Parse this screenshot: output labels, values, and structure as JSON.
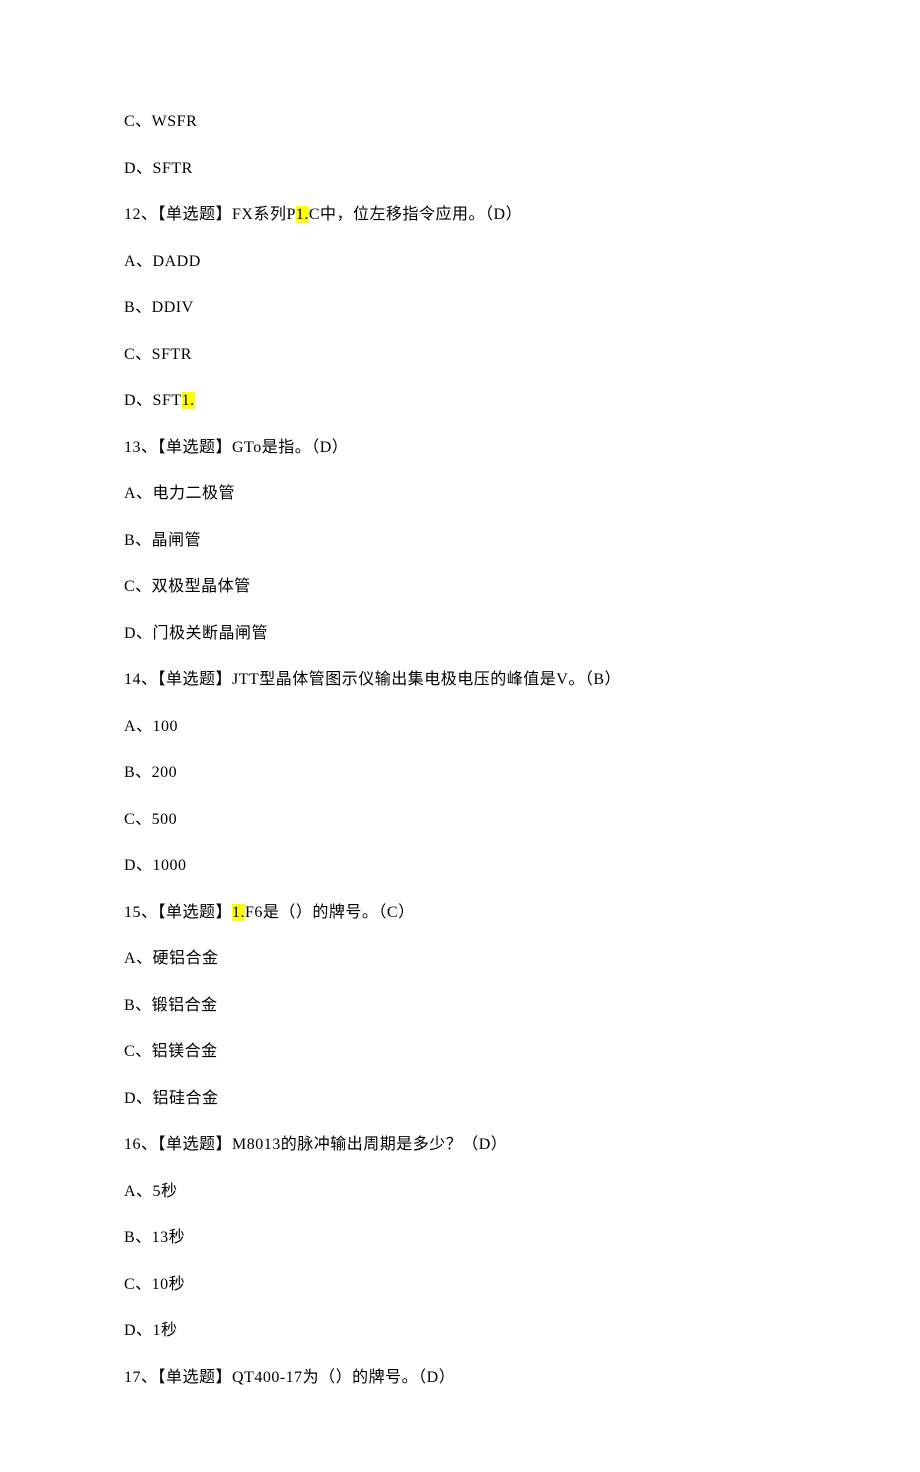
{
  "lines": {
    "l1": "C、WSFR",
    "l2": "D、SFTR",
    "l3_pre": "12、【单选题】FX系列P",
    "l3_hl": "1.",
    "l3_post": "C中，位左移指令应用。（D）",
    "l4": "A、DADD",
    "l5": "B、DDIV",
    "l6": "C、SFTR",
    "l7_pre": "D、SFT",
    "l7_hl": "1.",
    "l8": "13、【单选题】GTo是指。（D）",
    "l9": "A、电力二极管",
    "l10": "B、晶闸管",
    "l11": "C、双极型晶体管",
    "l12": "D、门极关断晶闸管",
    "l13": "14、【单选题】JTT型晶体管图示仪输出集电极电压的峰值是V。（B）",
    "l14": "A、100",
    "l15": "B、200",
    "l16": "C、500",
    "l17": "D、1000",
    "l18_pre": "15、【单选题】",
    "l18_hl": "1.",
    "l18_post": "F6是（）的牌号。（C）",
    "l19": "A、硬铝合金",
    "l20": "B、锻铝合金",
    "l21": "C、铝镁合金",
    "l22": "D、铝硅合金",
    "l23": "16、【单选题】M8013的脉冲输出周期是多少？（D）",
    "l24": "A、5秒",
    "l25": "B、13秒",
    "l26": "C、10秒",
    "l27": "D、1秒",
    "l28": "17、【单选题】QT400-17为（）的牌号。（D）"
  }
}
